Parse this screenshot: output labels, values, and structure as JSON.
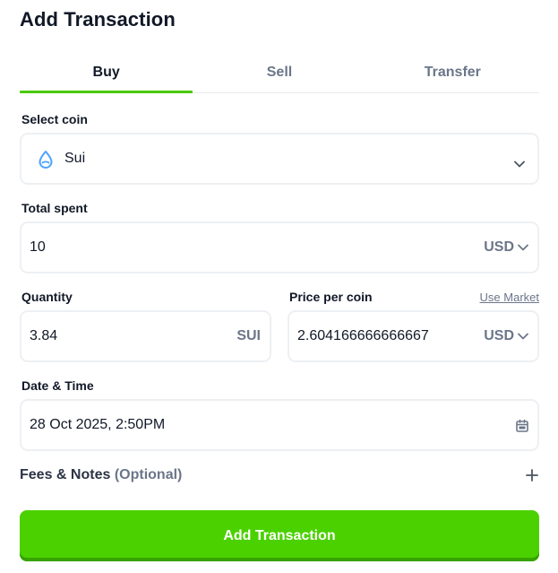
{
  "title": "Add Transaction",
  "tabs": [
    {
      "label": "Buy",
      "active": true
    },
    {
      "label": "Sell",
      "active": false
    },
    {
      "label": "Transfer",
      "active": false
    }
  ],
  "coin": {
    "label": "Select coin",
    "value": "Sui",
    "icon": "sui-drop-icon",
    "icon_color": "#4da2ff"
  },
  "total_spent": {
    "label": "Total spent",
    "value": "10",
    "currency": "USD"
  },
  "quantity": {
    "label": "Quantity",
    "value": "3.84",
    "unit": "SUI"
  },
  "price": {
    "label": "Price per coin",
    "link": "Use Market",
    "value": "2.604166666666667",
    "currency": "USD"
  },
  "datetime": {
    "label": "Date & Time",
    "value": "28 Oct 2025, 2:50PM"
  },
  "fees": {
    "label": "Fees & Notes",
    "optional": "(Optional)"
  },
  "submit_label": "Add Transaction",
  "colors": {
    "accent": "#4bd100",
    "muted": "#6b7689",
    "border": "#edf0f3"
  }
}
